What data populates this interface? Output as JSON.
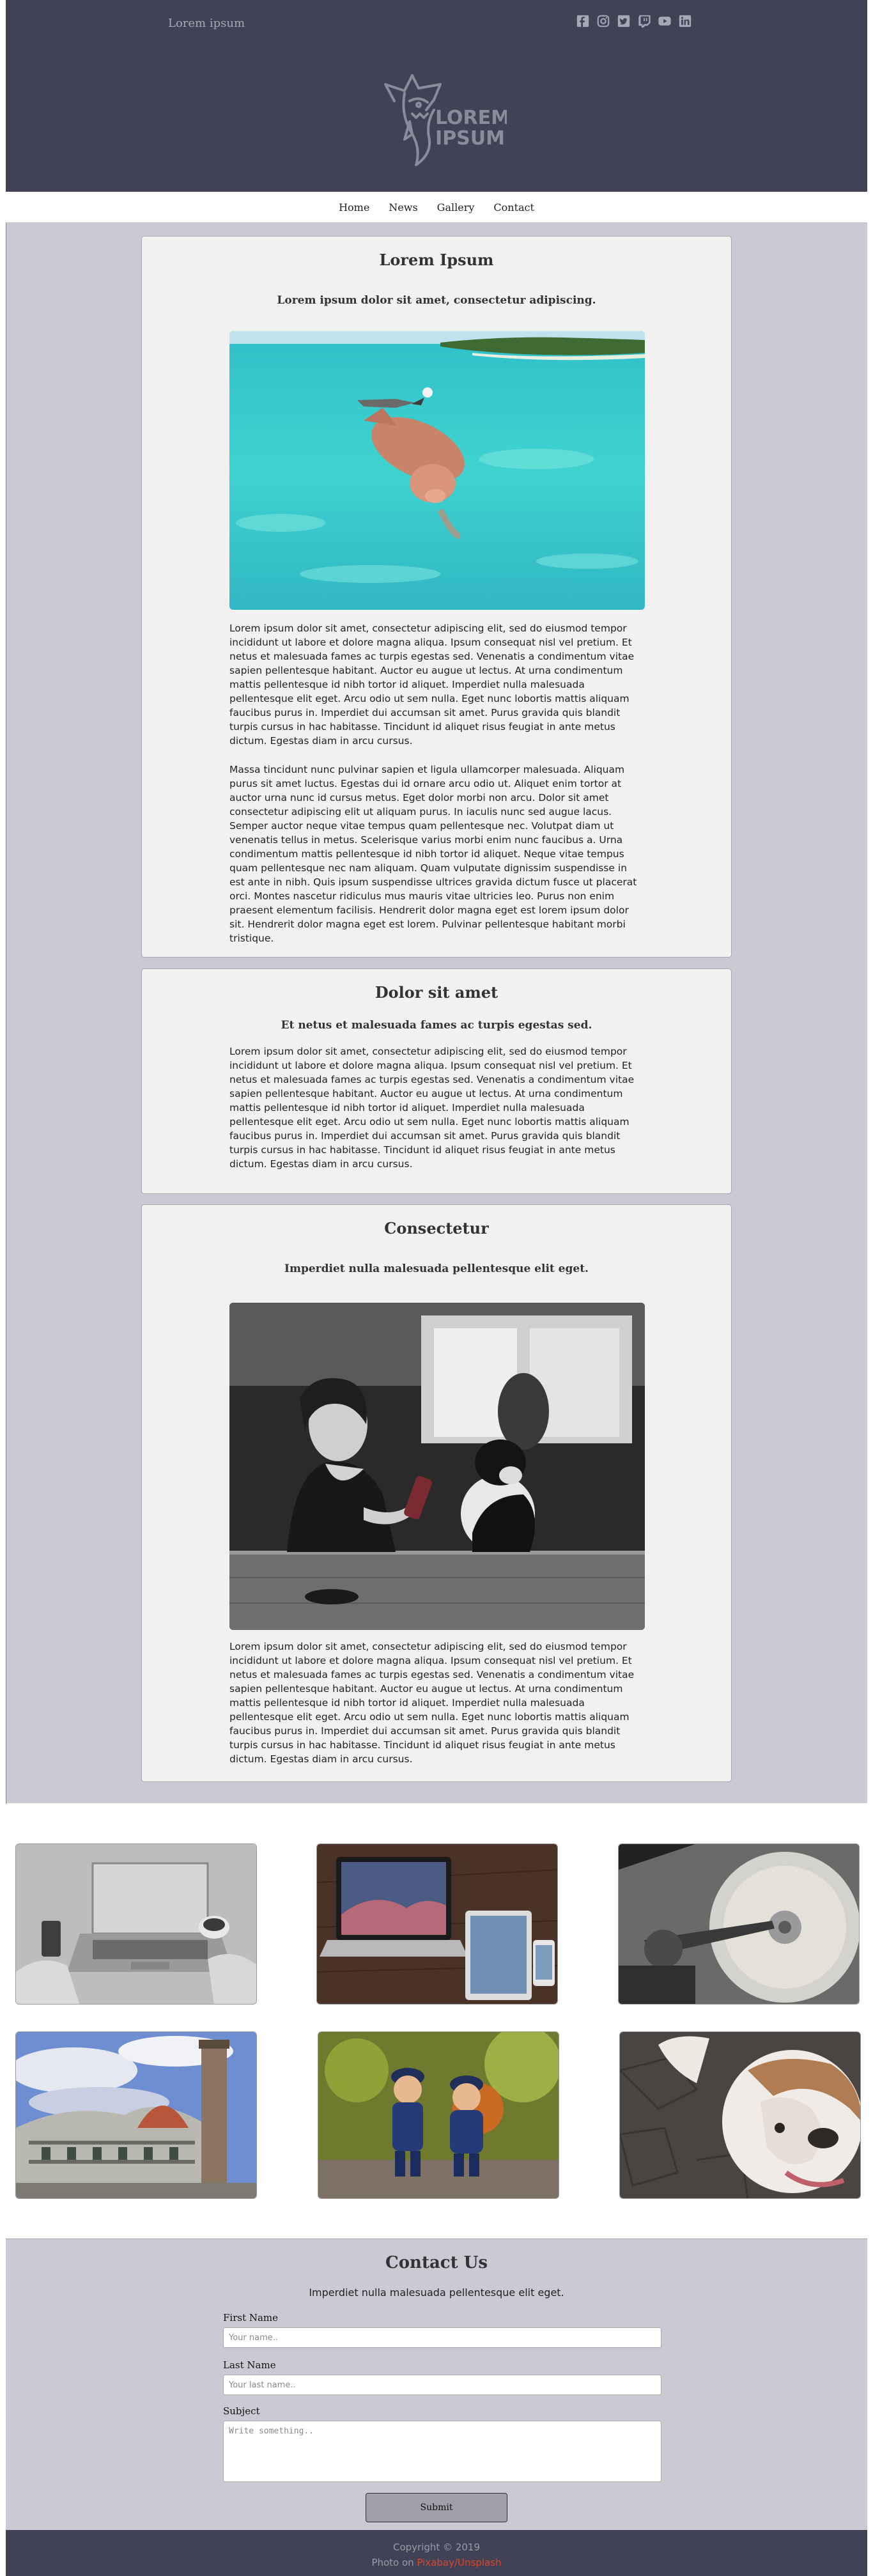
{
  "header": {
    "brand": "Lorem ipsum",
    "logo_text_line1": "LOREM",
    "logo_text_line2": "IPSUM",
    "socials": [
      "facebook-icon",
      "instagram-icon",
      "twitter-icon",
      "twitch-icon",
      "youtube-icon",
      "linkedin-icon"
    ],
    "colors": {
      "background": "#424256",
      "muted": "#a7a7b6"
    }
  },
  "nav": {
    "items": [
      {
        "label": "Home"
      },
      {
        "label": "News"
      },
      {
        "label": "Gallery"
      },
      {
        "label": "Contact"
      }
    ]
  },
  "articles": [
    {
      "title": "Lorem Ipsum",
      "subtitle": "Lorem ipsum dolor sit amet, consectetur adipiscing.",
      "paragraphs": [
        "Lorem ipsum dolor sit amet, consectetur adipiscing elit, sed do eiusmod tempor incididunt ut labore et dolore magna aliqua. Ipsum consequat nisl vel pretium. Et netus et malesuada fames ac turpis egestas sed. Venenatis a condimentum vitae sapien pellentesque habitant. Auctor eu augue ut lectus. At urna condimentum mattis pellentesque id nibh tortor id aliquet. Imperdiet nulla malesuada pellentesque elit eget. Arcu odio ut sem nulla. Eget nunc lobortis mattis aliquam faucibus purus in. Imperdiet dui accumsan sit amet. Purus gravida quis blandit turpis cursus in hac habitasse. Tincidunt id aliquet risus feugiat in ante metus dictum. Egestas diam in arcu cursus.",
        "Massa tincidunt nunc pulvinar sapien et ligula ullamcorper malesuada. Aliquam purus sit amet luctus. Egestas dui id ornare arcu odio ut. Aliquet enim tortor at auctor urna nunc id cursus metus. Eget dolor morbi non arcu. Dolor sit amet consectetur adipiscing elit ut aliquam purus. In iaculis nunc sed augue lacus. Semper auctor neque vitae tempus quam pellentesque nec. Volutpat diam ut venenatis tellus in metus. Scelerisque varius morbi enim nunc faucibus a. Urna condimentum mattis pellentesque id nibh tortor id aliquet. Neque vitae tempus quam pellentesque nec nam aliquam. Quam vulputate dignissim suspendisse in est ante in nibh. Quis ipsum suspendisse ultrices gravida dictum fusce ut placerat orci. Montes nascetur ridiculus mus mauris vitae ultricies leo. Purus non enim praesent elementum facilisis. Hendrerit dolor magna eget est lorem ipsum dolor sit. Hendrerit dolor magna eget est lorem. Pulvinar pellentesque habitant morbi tristique."
      ]
    },
    {
      "title": "Dolor sit amet",
      "subtitle": "Et netus et malesuada fames ac turpis egestas sed.",
      "paragraphs": [
        "Lorem ipsum dolor sit amet, consectetur adipiscing elit, sed do eiusmod tempor incididunt ut labore et dolore magna aliqua. Ipsum consequat nisl vel pretium. Et netus et malesuada fames ac turpis egestas sed. Venenatis a condimentum vitae sapien pellentesque habitant. Auctor eu augue ut lectus. At urna condimentum mattis pellentesque id nibh tortor id aliquet. Imperdiet nulla malesuada pellentesque elit eget. Arcu odio ut sem nulla. Eget nunc lobortis mattis aliquam faucibus purus in. Imperdiet dui accumsan sit amet. Purus gravida quis blandit turpis cursus in hac habitasse. Tincidunt id aliquet risus feugiat in ante metus dictum. Egestas diam in arcu cursus."
      ]
    },
    {
      "title": "Consectetur",
      "subtitle": "Imperdiet nulla malesuada pellentesque elit eget.",
      "paragraphs": [
        "Lorem ipsum dolor sit amet, consectetur adipiscing elit, sed do eiusmod tempor incididunt ut labore et dolore magna aliqua. Ipsum consequat nisl vel pretium. Et netus et malesuada fames ac turpis egestas sed. Venenatis a condimentum vitae sapien pellentesque habitant. Auctor eu augue ut lectus. At urna condimentum mattis pellentesque id nibh tortor id aliquet. Imperdiet nulla malesuada pellentesque elit eget. Arcu odio ut sem nulla. Eget nunc lobortis mattis aliquam faucibus purus in. Imperdiet dui accumsan sit amet. Purus gravida quis blandit turpis cursus in hac habitasse. Tincidunt id aliquet risus feugiat in ante metus dictum. Egestas diam in arcu cursus."
      ]
    }
  ],
  "contact": {
    "title": "Contact Us",
    "subtitle": "Imperdiet nulla malesuada pellentesque elit eget.",
    "first_name_label": "First Name",
    "first_name_placeholder": "Your name..",
    "last_name_label": "Last Name",
    "last_name_placeholder": "Your last name..",
    "subject_label": "Subject",
    "subject_placeholder": "Write something..",
    "submit_label": "Submit"
  },
  "footer": {
    "copyright": "Copyright © 2019",
    "photo_prefix": "Photo on ",
    "photo_source": "Pixabay/Unsplash",
    "colors": {
      "link": "#d9472b"
    }
  }
}
